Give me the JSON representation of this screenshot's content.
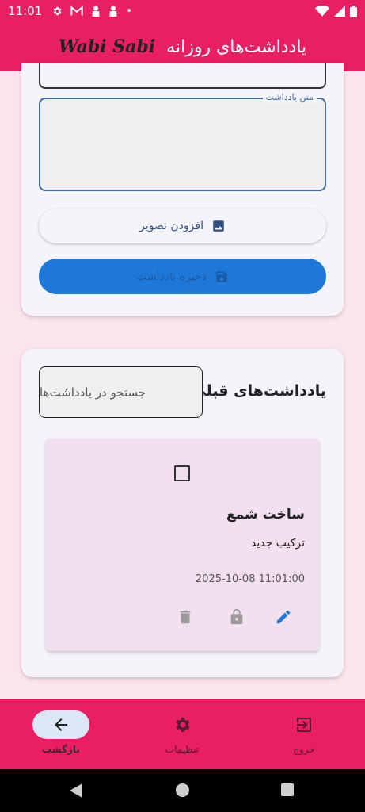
{
  "status_bar": {
    "time": "11:01",
    "icons": [
      "gear-icon",
      "gmail-icon",
      "lock-person-icon",
      "lock-person-icon",
      "dot-icon"
    ],
    "right_icons": [
      "wifi-icon",
      "signal-icon",
      "battery-icon"
    ]
  },
  "app_bar": {
    "title": "یادداشت‌های روزانه",
    "brand": "Wabi Sabi",
    "color": "#e91e63"
  },
  "editor": {
    "note_text_label": "متن یادداشت",
    "note_text_value": "",
    "add_image_label": "افزودن تصویر",
    "save_label": "ذخیره یادداشت",
    "save_color": "#1e78d8"
  },
  "notes_section": {
    "label": "یادداشت‌های قبلی:",
    "search_placeholder": "جستجو در یادداشت‌ها",
    "notes": [
      {
        "title": "ساخت شمع",
        "body": "ترکیب جدید",
        "datetime": "2025-10-08 11:01:00",
        "checked": false,
        "actions": [
          "edit-icon",
          "lock-icon",
          "delete-icon"
        ]
      }
    ]
  },
  "bottom_nav": {
    "items": [
      {
        "label": "بازگشت",
        "icon": "arrow-back-icon",
        "active": true
      },
      {
        "label": "تنظیمات",
        "icon": "gear-icon",
        "active": false
      },
      {
        "label": "خروج",
        "icon": "exit-icon",
        "active": false
      }
    ]
  }
}
